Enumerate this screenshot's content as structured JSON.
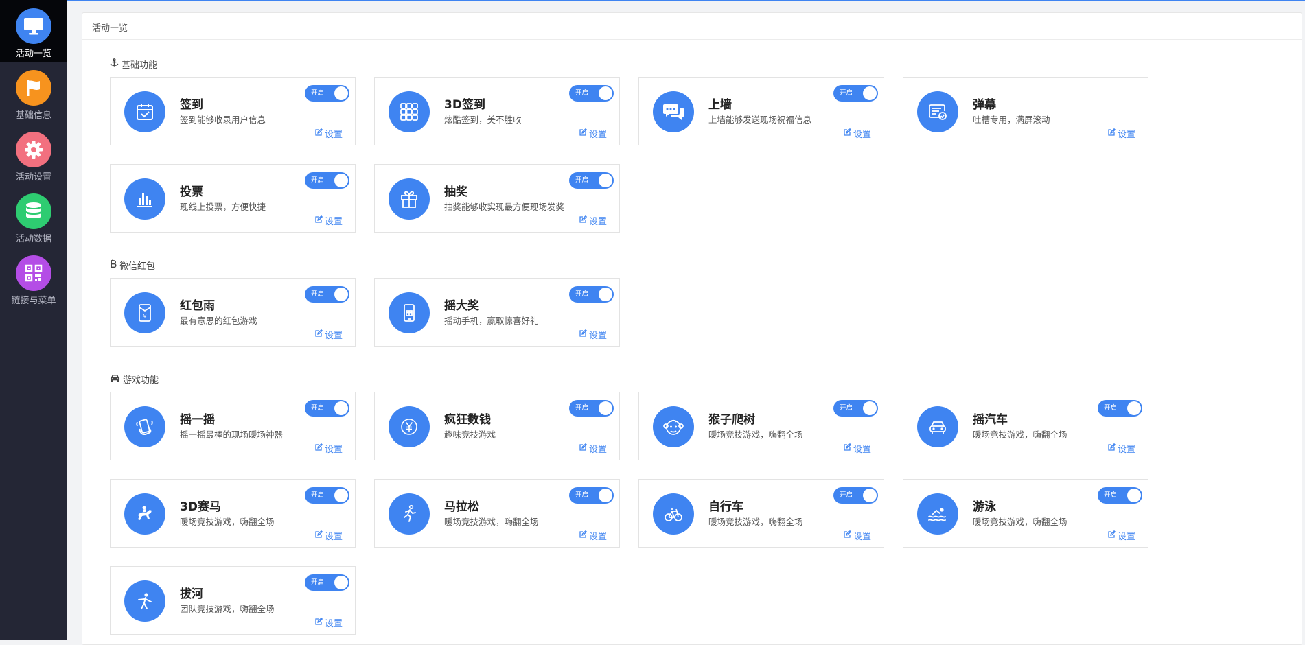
{
  "sidebar": {
    "items": [
      {
        "label": "活动一览",
        "icon": "monitor-icon",
        "color": "#3f84f1",
        "active": true
      },
      {
        "label": "基础信息",
        "icon": "flag-icon",
        "color": "#f7931e"
      },
      {
        "label": "活动设置",
        "icon": "gear-icon",
        "color": "#f2707f"
      },
      {
        "label": "活动数据",
        "icon": "database-icon",
        "color": "#2ecc71"
      },
      {
        "label": "链接与菜单",
        "icon": "qrcode-icon",
        "color": "#b44de6"
      }
    ]
  },
  "main": {
    "title": "活动一览",
    "toggle_label": "开启",
    "settings_label": "设置",
    "sections": [
      {
        "title": "基础功能",
        "icon": "anchor-icon",
        "cards": [
          {
            "title": "签到",
            "desc": "签到能够收录用户信息",
            "icon": "calendar-check-icon"
          },
          {
            "title": "3D签到",
            "desc": "炫酷签到，美不胜收",
            "icon": "grid-cube-icon"
          },
          {
            "title": "上墙",
            "desc": "上墙能够发送现场祝福信息",
            "icon": "chat-bubbles-icon"
          },
          {
            "title": "弹幕",
            "desc": "吐槽专用，满屏滚动",
            "icon": "danmaku-icon"
          },
          {
            "title": "投票",
            "desc": "现线上投票，方便快捷",
            "icon": "bar-chart-icon"
          },
          {
            "title": "抽奖",
            "desc": "抽奖能够收实现最方便现场发奖",
            "icon": "gift-icon"
          }
        ]
      },
      {
        "title": "微信红包",
        "icon": "bitcoin-icon",
        "cards": [
          {
            "title": "红包雨",
            "desc": "最有意思的红包游戏",
            "icon": "red-envelope-icon"
          },
          {
            "title": "摇大奖",
            "desc": "摇动手机，赢取惊喜好礼",
            "icon": "phone-gift-icon"
          }
        ]
      },
      {
        "title": "游戏功能",
        "icon": "car-icon",
        "cards": [
          {
            "title": "摇一摇",
            "desc": "摇一摇最棒的现场暖场神器",
            "icon": "shake-hand-icon"
          },
          {
            "title": "疯狂数钱",
            "desc": "趣味竞技游戏",
            "icon": "yen-coin-icon"
          },
          {
            "title": "猴子爬树",
            "desc": "暖场竞技游戏，嗨翻全场",
            "icon": "monkey-icon"
          },
          {
            "title": "摇汽车",
            "desc": "暖场竞技游戏，嗨翻全场",
            "icon": "car-front-icon"
          },
          {
            "title": "3D赛马",
            "desc": "暖场竞技游戏，嗨翻全场",
            "icon": "horse-rider-icon"
          },
          {
            "title": "马拉松",
            "desc": "暖场竞技游戏，嗨翻全场",
            "icon": "runner-icon"
          },
          {
            "title": "自行车",
            "desc": "暖场竞技游戏，嗨翻全场",
            "icon": "bicycle-icon"
          },
          {
            "title": "游泳",
            "desc": "暖场竞技游戏，嗨翻全场",
            "icon": "swimmer-icon"
          },
          {
            "title": "拔河",
            "desc": "团队竞技游戏，嗨翻全场",
            "icon": "tug-of-war-icon"
          }
        ]
      }
    ]
  }
}
